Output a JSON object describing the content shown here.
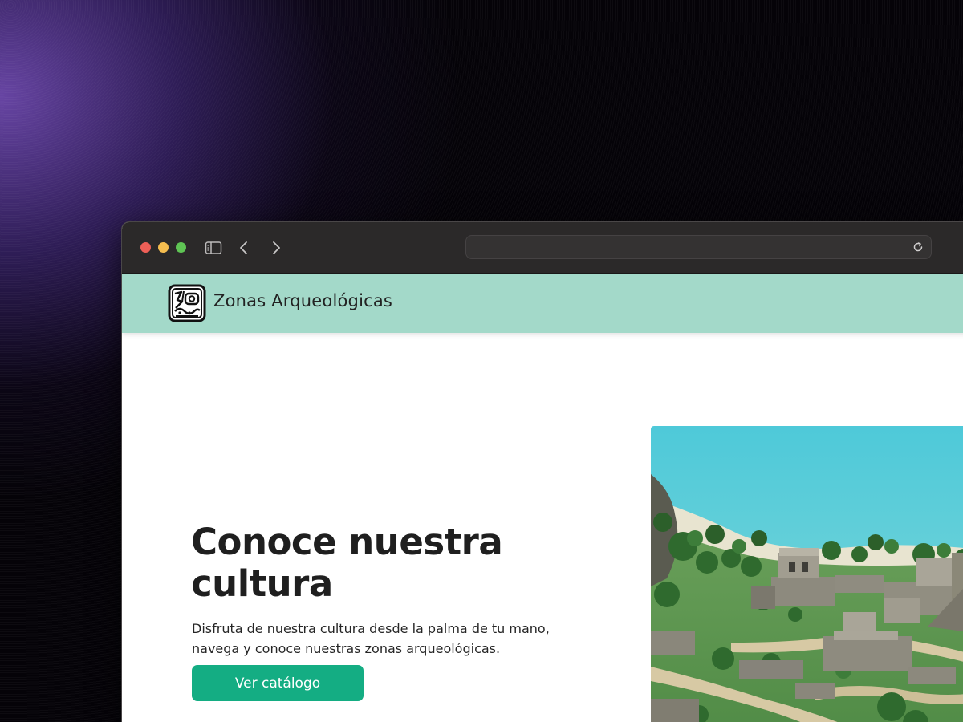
{
  "browser": {
    "url": ""
  },
  "site": {
    "brand": "Zonas Arqueológicas",
    "logo_icon": "maya-glyph-icon"
  },
  "hero": {
    "title": "Conoce nuestra cultura",
    "description": "Disfruta de nuestra cultura desde la palma de tu mano, navega y conoce nuestras zonas arqueológicas.",
    "cta_label": "Ver catálogo",
    "image_icon": "tulum-ruins-photo"
  },
  "colors": {
    "navbar": "#a3d9c9",
    "cta": "#14ad83",
    "titlebar": "#2b2929"
  }
}
